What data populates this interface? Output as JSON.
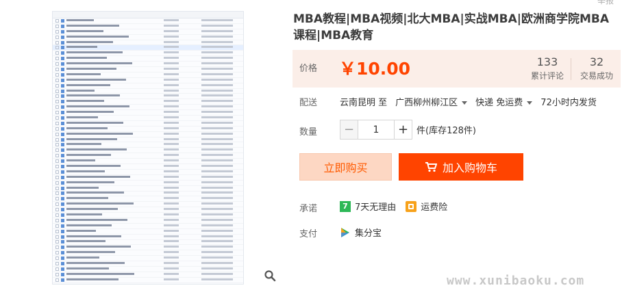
{
  "report_label": "举报",
  "title": "MBA教程|MBA视频|北大MBA|实战MBA|欧洲商学院MBA课程|MBA教育",
  "price": {
    "label": "价格",
    "value": "￥10.00"
  },
  "stats": {
    "reviews_count": "133",
    "reviews_label": "累计评论",
    "deals_count": "32",
    "deals_label": "交易成功"
  },
  "delivery": {
    "label": "配送",
    "from": "云南昆明 至",
    "to": "广西柳州柳江区",
    "shipping": "快递 免运费",
    "dispatch": "72小时内发货"
  },
  "quantity": {
    "label": "数量",
    "value": "1",
    "minus": "−",
    "plus": "+",
    "stock": "件(库存128件)"
  },
  "buttons": {
    "buy_now": "立即购买",
    "add_cart": "加入购物车"
  },
  "promise": {
    "label": "承诺",
    "badge": "7",
    "return": "7天无理由",
    "freight": "运费险"
  },
  "payment": {
    "label": "支付",
    "method": "集分宝"
  },
  "watermark": "www.xunibaoku.com",
  "colors": {
    "accent": "#ff4400",
    "price_bg": "#fbeee8",
    "buy_bg": "#fdd7c3",
    "promise_green": "#2db857",
    "freight_orange": "#f7a21b"
  }
}
